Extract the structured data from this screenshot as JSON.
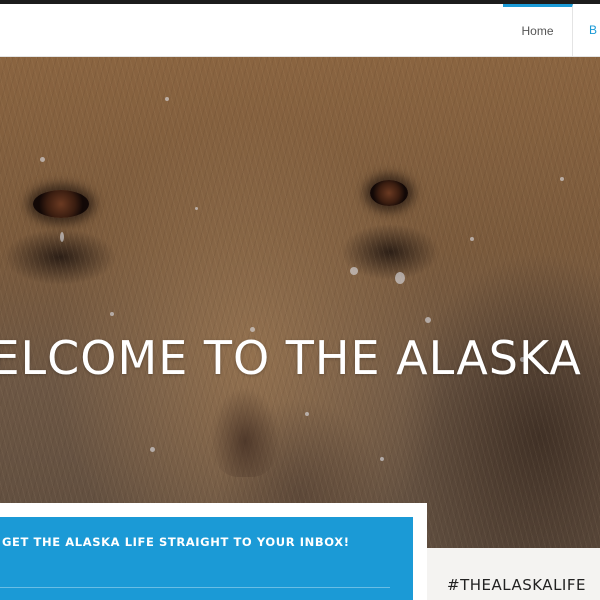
{
  "nav": {
    "items": [
      {
        "label": "Home",
        "active": true
      },
      {
        "label": "B"
      }
    ],
    "accent_color": "#1b9ad6"
  },
  "hero": {
    "title": "WELCOME TO THE ALASKA LIFE",
    "image": "brown-bear-close-up"
  },
  "newsletter": {
    "text": "GET THE ALASKA LIFE STRAIGHT TO YOUR INBOX!",
    "background_color": "#1b9ad6"
  },
  "social": {
    "hashtag": "#THEALASKALIFE"
  }
}
